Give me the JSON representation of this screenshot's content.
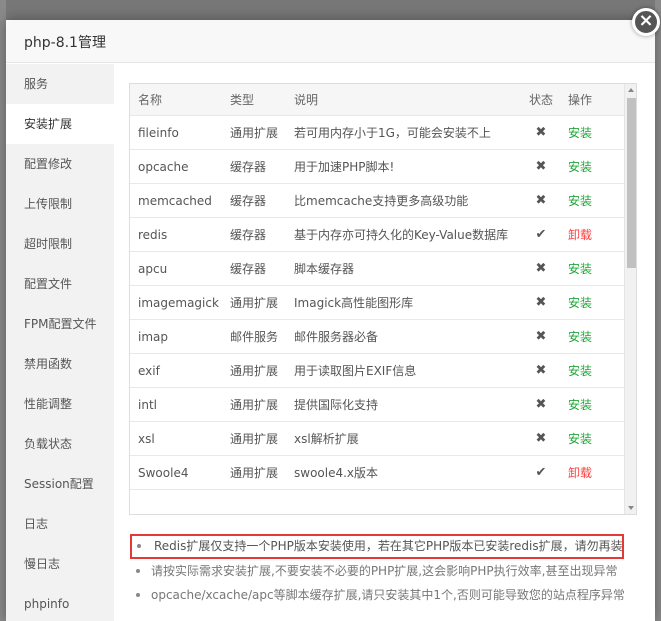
{
  "modal": {
    "title": "php-8.1管理",
    "close_glyph": "×"
  },
  "sidebar": {
    "items": [
      {
        "label": "服务"
      },
      {
        "label": "安装扩展",
        "active": true
      },
      {
        "label": "配置修改"
      },
      {
        "label": "上传限制"
      },
      {
        "label": "超时限制"
      },
      {
        "label": "配置文件"
      },
      {
        "label": "FPM配置文件"
      },
      {
        "label": "禁用函数"
      },
      {
        "label": "性能调整"
      },
      {
        "label": "负载状态"
      },
      {
        "label": "Session配置"
      },
      {
        "label": "日志"
      },
      {
        "label": "慢日志"
      },
      {
        "label": "phpinfo"
      }
    ]
  },
  "table": {
    "headers": {
      "name": "名称",
      "type": "类型",
      "desc": "说明",
      "status": "状态",
      "op": "操作"
    },
    "rows": [
      {
        "name": "fileinfo",
        "type": "通用扩展",
        "desc": "若可用内存小于1G，可能会安装不上",
        "status": "✖",
        "op": "安装"
      },
      {
        "name": "opcache",
        "type": "缓存器",
        "desc": "用于加速PHP脚本!",
        "status": "✖",
        "op": "安装"
      },
      {
        "name": "memcached",
        "type": "缓存器",
        "desc": "比memcache支持更多高级功能",
        "status": "✖",
        "op": "安装"
      },
      {
        "name": "redis",
        "type": "缓存器",
        "desc": "基于内存亦可持久化的Key-Value数据库",
        "status": "✔",
        "op": "卸载"
      },
      {
        "name": "apcu",
        "type": "缓存器",
        "desc": "脚本缓存器",
        "status": "✖",
        "op": "安装"
      },
      {
        "name": "imagemagick",
        "type": "通用扩展",
        "desc": "Imagick高性能图形库",
        "status": "✖",
        "op": "安装"
      },
      {
        "name": "imap",
        "type": "邮件服务",
        "desc": "邮件服务器必备",
        "status": "✖",
        "op": "安装"
      },
      {
        "name": "exif",
        "type": "通用扩展",
        "desc": "用于读取图片EXIF信息",
        "status": "✖",
        "op": "安装"
      },
      {
        "name": "intl",
        "type": "通用扩展",
        "desc": "提供国际化支持",
        "status": "✖",
        "op": "安装"
      },
      {
        "name": "xsl",
        "type": "通用扩展",
        "desc": "xsl解析扩展",
        "status": "✖",
        "op": "安装"
      },
      {
        "name": "Swoole4",
        "type": "通用扩展",
        "desc": "swoole4.x版本",
        "status": "✔",
        "op": "卸载"
      }
    ]
  },
  "notes": [
    "Redis扩展仅支持一个PHP版本安装使用，若在其它PHP版本已安装redis扩展，请勿再装",
    "请按实际需求安装扩展,不要安装不必要的PHP扩展,这会影响PHP执行效率,甚至出现异常",
    "opcache/xcache/apc等脚本缓存扩展,请只安装其中1个,否则可能导致您的站点程序异常"
  ],
  "colors": {
    "install": "#20a53a",
    "uninstall": "#ff3c3c",
    "highlight_border": "#e53935"
  }
}
